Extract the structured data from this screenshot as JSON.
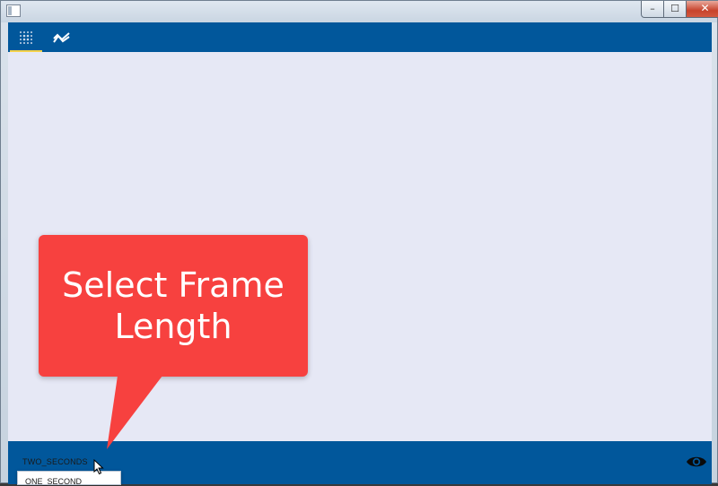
{
  "window": {
    "title": "",
    "controls": {
      "minimize": "–",
      "maximize": "☐",
      "close": "✕"
    }
  },
  "toolbar": {
    "tabs": [
      {
        "icon": "grid-icon",
        "selected": true
      },
      {
        "icon": "trend-chart-icon",
        "selected": false
      }
    ]
  },
  "statusbar": {
    "frame_length_value": "TWO_SECONDS",
    "dropdown_option": "ONE_SECOND",
    "visibility_icon": "eye-icon"
  },
  "callout": {
    "text": "Select Frame Length",
    "color": "#f7413f"
  },
  "colors": {
    "toolbar": "#01579b",
    "content_bg": "#e6e8f5",
    "tab_indicator": "#f6d24a"
  }
}
